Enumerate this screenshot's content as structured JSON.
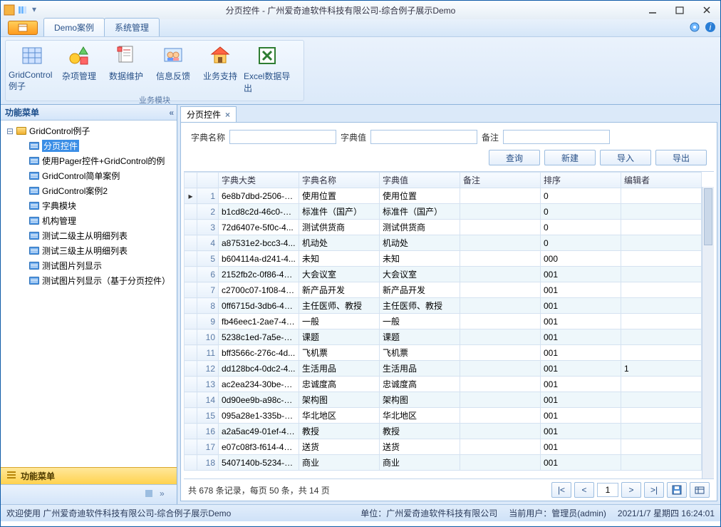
{
  "title": "分页控件 - 广州爱奇迪软件科技有限公司-综合例子展示Demo",
  "menutabs": {
    "t1": "Demo案例",
    "t2": "系统管理"
  },
  "ribbon": {
    "items": [
      {
        "label": "GridControl例子"
      },
      {
        "label": "杂项管理"
      },
      {
        "label": "数据维护"
      },
      {
        "label": "信息反馈"
      },
      {
        "label": "业务支持"
      },
      {
        "label": "Excel数据导出"
      }
    ],
    "group": "业务模块"
  },
  "side": {
    "title": "功能菜单",
    "root": "GridControl例子",
    "nodes": [
      "分页控件",
      "使用Pager控件+GridControl的例",
      "GridControl简单案例",
      "GridControl案例2",
      "字典模块",
      "机构管理",
      "测试二级主从明细列表",
      "测试三级主从明细列表",
      "测试图片列显示",
      "测试图片列显示（基于分页控件）"
    ],
    "foot": "功能菜单"
  },
  "doc": {
    "tab": "分页控件"
  },
  "search": {
    "f1": "字典名称",
    "f2": "字典值",
    "f3": "备注"
  },
  "buttons": {
    "query": "查询",
    "new": "新建",
    "import": "导入",
    "export": "导出"
  },
  "columns": [
    "字典大类",
    "字典名称",
    "字典值",
    "备注",
    "排序",
    "编辑者"
  ],
  "rows": [
    {
      "c1": "6e8b7dbd-2506-4...",
      "c2": "使用位置",
      "c3": "使用位置",
      "c4": "",
      "c5": "0",
      "c6": ""
    },
    {
      "c1": "b1cd8c2d-46c0-4c...",
      "c2": "标准件（国产）",
      "c3": "标准件（国产）",
      "c4": "",
      "c5": "0",
      "c6": ""
    },
    {
      "c1": "72d6407e-5f0c-4...",
      "c2": "测试供货商",
      "c3": "测试供货商",
      "c4": "",
      "c5": "0",
      "c6": ""
    },
    {
      "c1": "a87531e2-bcc3-4...",
      "c2": "机动处",
      "c3": "机动处",
      "c4": "",
      "c5": "0",
      "c6": ""
    },
    {
      "c1": "b604114a-d241-4...",
      "c2": "未知",
      "c3": "未知",
      "c4": "",
      "c5": "000",
      "c6": ""
    },
    {
      "c1": "2152fb2c-0f86-4b...",
      "c2": "大会议室",
      "c3": "大会议室",
      "c4": "",
      "c5": "001",
      "c6": ""
    },
    {
      "c1": "c2700c07-1f08-4c...",
      "c2": "新产品开发",
      "c3": "新产品开发",
      "c4": "",
      "c5": "001",
      "c6": ""
    },
    {
      "c1": "0ff6715d-3db6-45...",
      "c2": "主任医师、教授",
      "c3": "主任医师、教授",
      "c4": "",
      "c5": "001",
      "c6": ""
    },
    {
      "c1": "fb46eec1-2ae7-42...",
      "c2": "一般",
      "c3": "一般",
      "c4": "",
      "c5": "001",
      "c6": ""
    },
    {
      "c1": "5238c1ed-7a5e-4...",
      "c2": "课题",
      "c3": "课题",
      "c4": "",
      "c5": "001",
      "c6": ""
    },
    {
      "c1": "bff3566c-276c-4d...",
      "c2": "飞机票",
      "c3": "飞机票",
      "c4": "",
      "c5": "001",
      "c6": ""
    },
    {
      "c1": "dd128bc4-0dc2-4...",
      "c2": "生活用品",
      "c3": "生活用品",
      "c4": "",
      "c5": "001",
      "c6": "1"
    },
    {
      "c1": "ac2ea234-30be-4f...",
      "c2": "忠诚度高",
      "c3": "忠诚度高",
      "c4": "",
      "c5": "001",
      "c6": ""
    },
    {
      "c1": "0d90ee9b-a98c-4f...",
      "c2": "架构图",
      "c3": "架构图",
      "c4": "",
      "c5": "001",
      "c6": ""
    },
    {
      "c1": "095a28e1-335b-4...",
      "c2": "华北地区",
      "c3": "华北地区",
      "c4": "",
      "c5": "001",
      "c6": ""
    },
    {
      "c1": "a2a5ac49-01ef-40...",
      "c2": "教授",
      "c3": "教授",
      "c4": "",
      "c5": "001",
      "c6": ""
    },
    {
      "c1": "e07c08f3-f614-47...",
      "c2": "送货",
      "c3": "送货",
      "c4": "",
      "c5": "001",
      "c6": ""
    },
    {
      "c1": "5407140b-5234-4...",
      "c2": "商业",
      "c3": "商业",
      "c4": "",
      "c5": "001",
      "c6": ""
    }
  ],
  "pager": {
    "info": "共 678 条记录，每页 50 条，共 14 页",
    "first": "|<",
    "prev": "<",
    "page": "1",
    "next": ">",
    "last": ">|"
  },
  "status": {
    "welcome": "欢迎使用 广州爱奇迪软件科技有限公司-综合例子展示Demo",
    "company": "单位：广州爱奇迪软件科技有限公司",
    "user": "当前用户：管理员(admin)",
    "time": "2021/1/7 星期四 16:24:01"
  }
}
